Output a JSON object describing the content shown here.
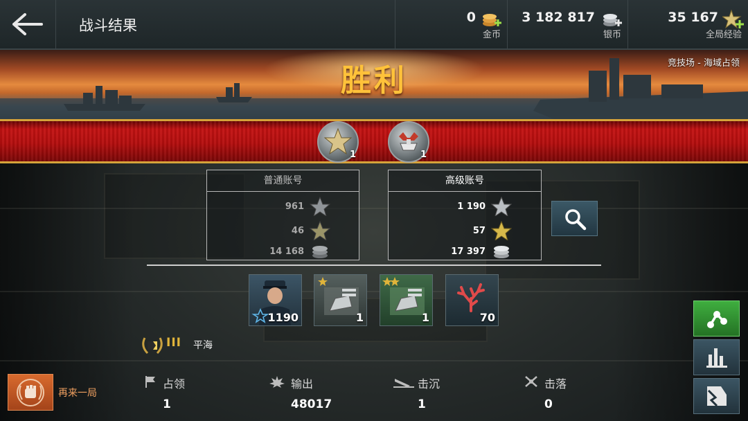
{
  "header": {
    "title": "战斗结果",
    "currencies": [
      {
        "value": "0",
        "label": "金币",
        "icon": "gold-coins-icon"
      },
      {
        "value": "3 182 817",
        "label": "银币",
        "icon": "silver-coins-icon"
      },
      {
        "value": "35 167",
        "label": "全局经验",
        "icon": "global-xp-star-icon"
      }
    ]
  },
  "banner": {
    "result": "胜利",
    "mode": "竞技场 - 海域占领"
  },
  "medals": [
    {
      "icon": "star-medal-icon",
      "count": "1"
    },
    {
      "icon": "warship-medal-icon",
      "count": "1"
    }
  ],
  "accounts": {
    "basic": {
      "title": "普通账号",
      "xp": "961",
      "commander_xp": "46",
      "silver": "14 168"
    },
    "premium": {
      "title": "高级账号",
      "xp": "1 190",
      "commander_xp": "57",
      "silver": "17 397"
    }
  },
  "rewards": [
    {
      "icon": "commander-icon",
      "value": "1190"
    },
    {
      "icon": "gun-module-1star-icon",
      "value": "1"
    },
    {
      "icon": "gun-module-2star-icon",
      "value": "1"
    },
    {
      "icon": "coral-icon",
      "value": "70"
    }
  ],
  "rank": {
    "roman": "III",
    "label": "平海"
  },
  "play_again": "再来一局",
  "stats": [
    {
      "label": "占领",
      "value": "1",
      "icon": "flag-icon"
    },
    {
      "label": "输出",
      "value": "48017",
      "icon": "explosion-icon"
    },
    {
      "label": "击沉",
      "value": "1",
      "icon": "sinking-ship-icon"
    },
    {
      "label": "击落",
      "value": "0",
      "icon": "plane-shot-down-icon"
    }
  ],
  "colors": {
    "victory": "#ffc23a",
    "ribbon": "#b50e0e",
    "share_button": "#2f8f2f",
    "play_again_button": "#c85a24",
    "premium_star": "#d6b84a"
  }
}
